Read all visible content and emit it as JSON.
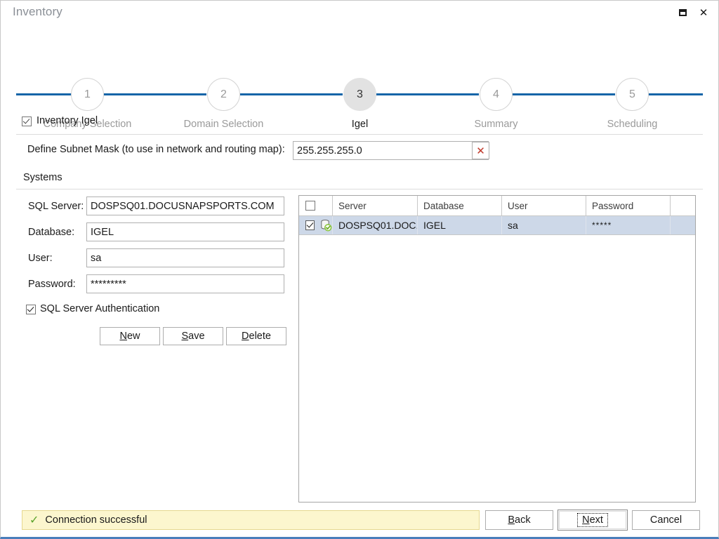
{
  "window": {
    "title": "Inventory",
    "controls": [
      {
        "name": "maximize-button",
        "icon": "maximize-icon"
      },
      {
        "name": "close-button",
        "icon": "close-icon"
      }
    ]
  },
  "stepper": {
    "steps": [
      {
        "number": "1",
        "label": "Company Selection",
        "active": false
      },
      {
        "number": "2",
        "label": "Domain Selection",
        "active": false
      },
      {
        "number": "3",
        "label": "Igel",
        "active": true
      },
      {
        "number": "4",
        "label": "Summary",
        "active": false
      },
      {
        "number": "5",
        "label": "Scheduling",
        "active": false
      }
    ]
  },
  "main": {
    "inventory_toggle_label": "Inventory Igel",
    "inventory_toggle_checked": true,
    "subnet": {
      "label": "Define Subnet Mask (to use in network and routing map):",
      "value": "255.255.255.0",
      "clear_icon": "✕"
    },
    "systems_label": "Systems",
    "form": {
      "sql_server_label": "SQL Server:",
      "sql_server_value": "DOSPSQ01.DOCUSNAPSPORTS.COM",
      "database_label": "Database:",
      "database_value": "IGEL",
      "user_label": "User:",
      "user_value": "sa",
      "password_label": "Password:",
      "password_value": "*********",
      "auth_label": "SQL Server Authentication",
      "auth_checked": true
    },
    "form_buttons": [
      {
        "name": "new-button",
        "accel": "N",
        "rest": "ew"
      },
      {
        "name": "save-button",
        "accel": "S",
        "rest": "ave"
      },
      {
        "name": "delete-button",
        "accel": "D",
        "rest": "elete"
      }
    ],
    "grid": {
      "columns": [
        "",
        "Server",
        "Database",
        "User",
        "Password",
        ""
      ],
      "rows": [
        {
          "checked": true,
          "status_icon": "database-ok-icon",
          "server": "DOSPSQ01.DOC...",
          "database": "IGEL",
          "user": "sa",
          "password": "*****",
          "selected": true
        }
      ]
    }
  },
  "footer": {
    "status_text": "Connection successful",
    "status_icon": "✓",
    "buttons": [
      {
        "name": "back-button",
        "accel": "B",
        "rest": "ack",
        "focused": false
      },
      {
        "name": "next-button",
        "accel": "N",
        "rest": "ext",
        "focused": true
      },
      {
        "name": "cancel-button",
        "accel": "",
        "rest": "Cancel",
        "focused": false
      }
    ]
  },
  "colors": {
    "accent": "#1565a8",
    "selection": "#cdd8e8",
    "status_bg": "#fcf6ce",
    "status_check": "#5ba32b",
    "clear_x": "#c0392b"
  }
}
